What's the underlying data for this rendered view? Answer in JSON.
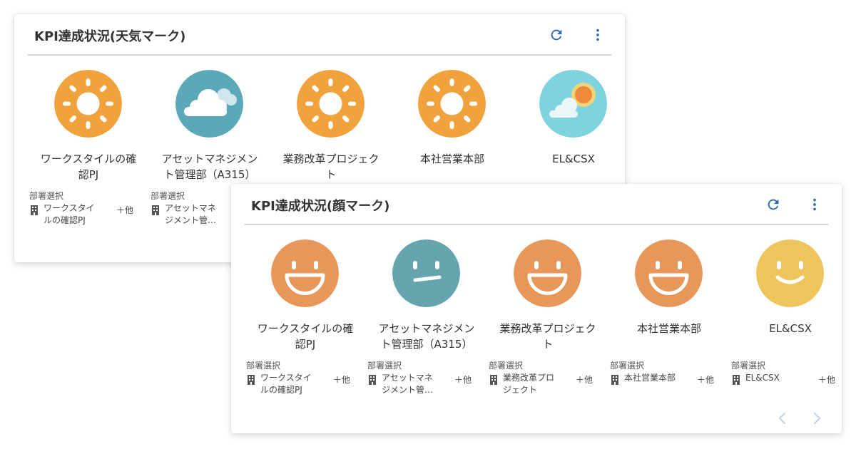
{
  "colors": {
    "sun_orange": "#f0a33c",
    "weather_teal": "#5ba8b8",
    "weather_light_teal": "#7ed3de",
    "sunset_orange": "#ed8a3c",
    "face_orange": "#e8975a",
    "face_teal": "#66a5ad",
    "face_yellow": "#edc55c",
    "accent_blue": "#2f67b2",
    "nav_arrow": "#c4d4e8"
  },
  "weather_card": {
    "title": "KPI達成状況(天気マーク)",
    "refresh_icon": "refresh-icon",
    "more_icon": "more-vertical-icon",
    "items": [
      {
        "name_line1": "ワークスタイルの確",
        "name_line2": "認PJ",
        "icon": "sun-icon",
        "dept_label": "部署選択",
        "dept_line1": "ワークスタイ",
        "dept_line2": "ルの確認PJ",
        "more": "＋他"
      },
      {
        "name_line1": "アセットマネジメン",
        "name_line2": "ト管理部（A315）",
        "icon": "cloudy-icon",
        "dept_label": "部署選択",
        "dept_line1": "アセットマネ",
        "dept_line2": "ジメント管…",
        "more": ""
      },
      {
        "name_line1": "業務改革プロジェク",
        "name_line2": "ト",
        "icon": "sun-icon",
        "dept_label": "",
        "dept_line1": "",
        "dept_line2": "",
        "more": ""
      },
      {
        "name_line1": "本社営業本部",
        "name_line2": "",
        "icon": "sun-icon",
        "dept_label": "",
        "dept_line1": "",
        "dept_line2": "",
        "more": ""
      },
      {
        "name_line1": "EL&CSX",
        "name_line2": "",
        "icon": "partly-sunny-icon",
        "dept_label": "",
        "dept_line1": "",
        "dept_line2": "",
        "more": ""
      }
    ]
  },
  "face_card": {
    "title": "KPI達成状況(顔マーク)",
    "refresh_icon": "refresh-icon",
    "more_icon": "more-vertical-icon",
    "items": [
      {
        "name_line1": "ワークスタイルの確",
        "name_line2": "認PJ",
        "icon": "laughing-face-icon",
        "dept_label": "部署選択",
        "dept_line1": "ワークスタイ",
        "dept_line2": "ルの確認PJ",
        "more": "＋他"
      },
      {
        "name_line1": "アセットマネジメン",
        "name_line2": "ト管理部（A315）",
        "icon": "neutral-face-icon",
        "dept_label": "部署選択",
        "dept_line1": "アセットマネ",
        "dept_line2": "ジメント管…",
        "more": "＋他"
      },
      {
        "name_line1": "業務改革プロジェク",
        "name_line2": "ト",
        "icon": "laughing-face-icon",
        "dept_label": "部署選択",
        "dept_line1": "業務改革プロ",
        "dept_line2": "ジェクト",
        "more": "＋他"
      },
      {
        "name_line1": "本社営業本部",
        "name_line2": "",
        "icon": "laughing-face-icon",
        "dept_label": "部署選択",
        "dept_line1": "本社営業本部",
        "dept_line2": "",
        "more": "＋他"
      },
      {
        "name_line1": "EL&CSX",
        "name_line2": "",
        "icon": "smiling-face-icon",
        "dept_label": "部署選択",
        "dept_line1": "EL&CSX",
        "dept_line2": "",
        "more": "＋他"
      }
    ],
    "prev_icon": "chevron-left-icon",
    "next_icon": "chevron-right-icon"
  }
}
